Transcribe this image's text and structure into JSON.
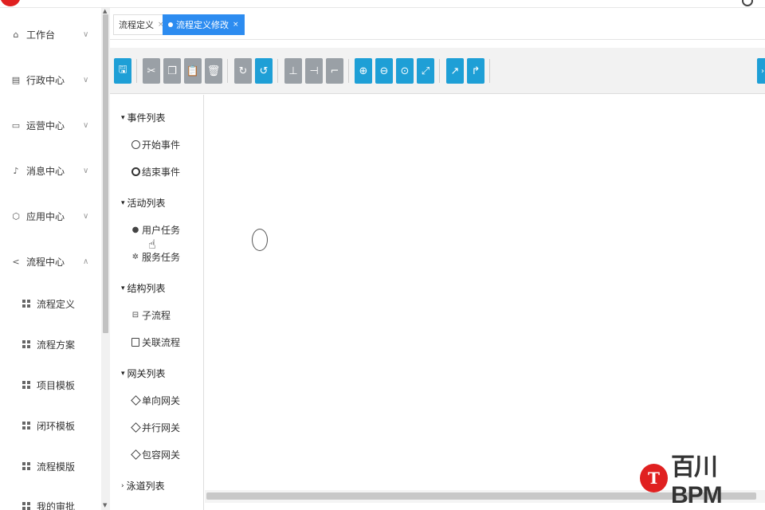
{
  "sidebar": {
    "items": [
      {
        "label": "工作台",
        "icon": "home-icon",
        "chevron": "∨"
      },
      {
        "label": "行政中心",
        "icon": "building-icon",
        "chevron": "∨"
      },
      {
        "label": "运营中心",
        "icon": "presentation-icon",
        "chevron": "∨"
      },
      {
        "label": "消息中心",
        "icon": "bell-icon",
        "chevron": "∨"
      },
      {
        "label": "应用中心",
        "icon": "hexagon-icon",
        "chevron": "∨"
      },
      {
        "label": "流程中心",
        "icon": "share-icon",
        "chevron": "∧"
      }
    ],
    "sub_items": [
      {
        "label": "流程定义"
      },
      {
        "label": "流程方案"
      },
      {
        "label": "项目模板"
      },
      {
        "label": "闭环模板"
      },
      {
        "label": "流程模版"
      },
      {
        "label": "我的审批"
      }
    ]
  },
  "tabs": [
    {
      "label": "流程定义",
      "close": "×"
    },
    {
      "label": "流程定义修改",
      "close": "×"
    }
  ],
  "toolbar": {
    "buttons": [
      {
        "icon": "save-icon",
        "glyph": "🖫"
      },
      {
        "icon": "cut-icon",
        "glyph": "✂"
      },
      {
        "icon": "copy-icon",
        "glyph": "❐"
      },
      {
        "icon": "paste-icon",
        "glyph": "📋"
      },
      {
        "icon": "delete-icon",
        "glyph": "🗑"
      },
      {
        "icon": "redo-icon",
        "glyph": "↻"
      },
      {
        "icon": "undo-icon",
        "glyph": "↺"
      },
      {
        "icon": "align-vertical-icon",
        "glyph": "⊥"
      },
      {
        "icon": "align-horizontal-icon",
        "glyph": "⊣"
      },
      {
        "icon": "connector-icon",
        "glyph": "⌐"
      },
      {
        "icon": "zoom-in-icon",
        "glyph": "⊕"
      },
      {
        "icon": "zoom-out-icon",
        "glyph": "⊖"
      },
      {
        "icon": "zoom-reset-icon",
        "glyph": "⊙"
      },
      {
        "icon": "fit-screen-icon",
        "glyph": "⤢"
      },
      {
        "icon": "flow-line-icon",
        "glyph": "↗"
      },
      {
        "icon": "flow-branch-icon",
        "glyph": "↱"
      }
    ],
    "edge_glyph": "›"
  },
  "palette": {
    "sections": [
      {
        "title": "事件列表",
        "items": [
          {
            "label": "开始事件",
            "icon": "start-event-icon"
          },
          {
            "label": "结束事件",
            "icon": "end-event-icon"
          }
        ]
      },
      {
        "title": "活动列表",
        "items": [
          {
            "label": "用户任务",
            "icon": "user-icon"
          },
          {
            "label": "服务任务",
            "icon": "gear-icon"
          }
        ]
      },
      {
        "title": "结构列表",
        "items": [
          {
            "label": "子流程",
            "icon": "subprocess-icon"
          },
          {
            "label": "关联流程",
            "icon": "call-activity-icon"
          }
        ]
      },
      {
        "title": "网关列表",
        "items": [
          {
            "label": "单向网关",
            "icon": "exclusive-gateway-icon"
          },
          {
            "label": "并行网关",
            "icon": "parallel-gateway-icon"
          },
          {
            "label": "包容网关",
            "icon": "inclusive-gateway-icon"
          }
        ]
      },
      {
        "title": "泳道列表",
        "items": []
      }
    ],
    "expanded_marker": "▾",
    "collapsed_marker": "›"
  },
  "watermark": {
    "logo_letter": "T",
    "text": "百川BPM"
  },
  "colors": {
    "accent": "#1e9fd6",
    "tab_active": "#2d8cf0",
    "brand_red": "#e02020"
  }
}
